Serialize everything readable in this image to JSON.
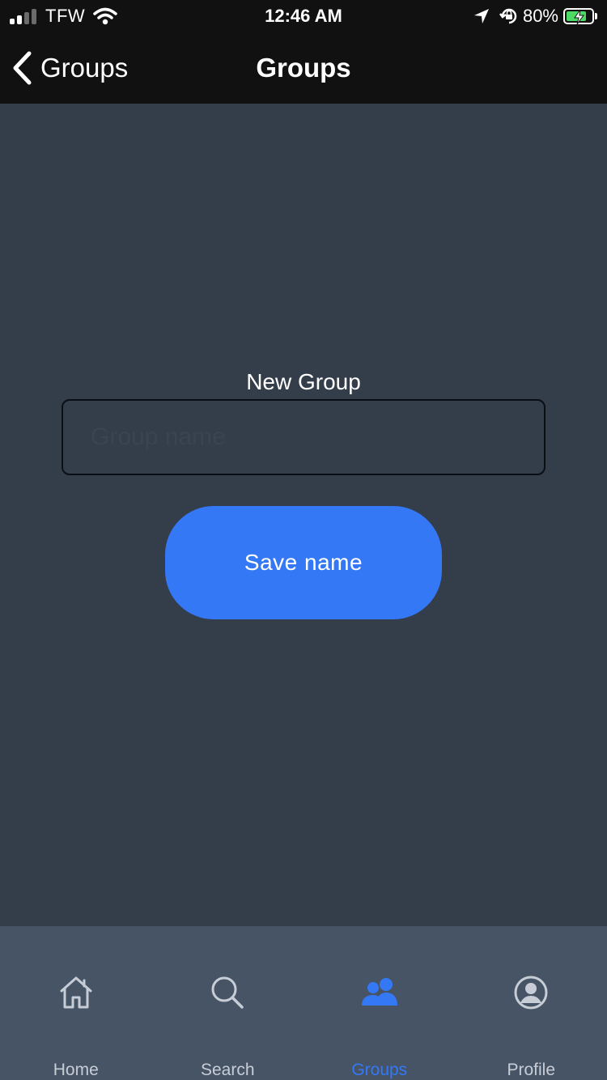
{
  "status_bar": {
    "carrier": "TFW",
    "time": "12:46 AM",
    "battery_percent": "80%",
    "battery_level": 0.8,
    "icons": [
      "signal-icon",
      "wifi-icon",
      "location-icon",
      "orientation-lock-icon",
      "battery-charging-icon"
    ]
  },
  "nav": {
    "back_label": "Groups",
    "title": "Groups"
  },
  "form": {
    "label": "New Group",
    "input_placeholder": "Group name",
    "input_value": "",
    "save_label": "Save name"
  },
  "tabs": [
    {
      "label": "Home",
      "icon": "home-icon",
      "active": false
    },
    {
      "label": "Search",
      "icon": "search-icon",
      "active": false
    },
    {
      "label": "Groups",
      "icon": "groups-icon",
      "active": true
    },
    {
      "label": "Profile",
      "icon": "profile-icon",
      "active": false
    }
  ],
  "colors": {
    "background": "#343d4a",
    "bars": "#111111",
    "tab_bar": "#465466",
    "accent": "#3478f6",
    "inactive_icon": "#c7cdd6"
  }
}
